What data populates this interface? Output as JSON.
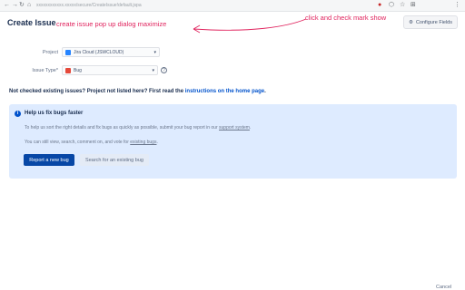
{
  "browser": {
    "nav_icons": [
      "←",
      "→",
      "↻",
      "⌂"
    ],
    "url": "xxxxxxxxxxxx.xxxxx/secure/CreateIssue!default.jspa",
    "extension_icons": [
      "●",
      "⬡",
      "☆",
      "⊞",
      "⋮"
    ]
  },
  "header": {
    "title": "Create Issue",
    "configure_label": "Configure Fields"
  },
  "annotations": {
    "left": "create issue pop up dialog maximize",
    "right": "click and check mark show",
    "color": "#e0245e"
  },
  "form": {
    "project_label": "Project",
    "project_value": "Jira Cloud (JSWCLOUD)",
    "issue_type_label": "Issue Type*",
    "issue_type_value": "Bug",
    "help_symbol": "?"
  },
  "notice": {
    "text": "Not checked existing issues? Project not listed here? First read the ",
    "link": "instructions on the home page",
    "end": "."
  },
  "info": {
    "title": "Help us fix bugs faster",
    "line1_text": "To help us sort the right details and fix bugs as quickly as possible, submit your bug report in our ",
    "line1_link": "support system",
    "line1_end": ".",
    "line2_text": "You can still view, search, comment on, and vote for ",
    "line2_link": "existing bugs",
    "line2_end": ".",
    "primary_button": "Report a new bug",
    "secondary_button": "Search for an existing bug"
  },
  "footer": {
    "cancel": "Cancel"
  },
  "colors": {
    "primary": "#0747a6",
    "info_bg": "#deebff",
    "bug_red": "#e5493a",
    "project_blue": "#2684ff"
  }
}
